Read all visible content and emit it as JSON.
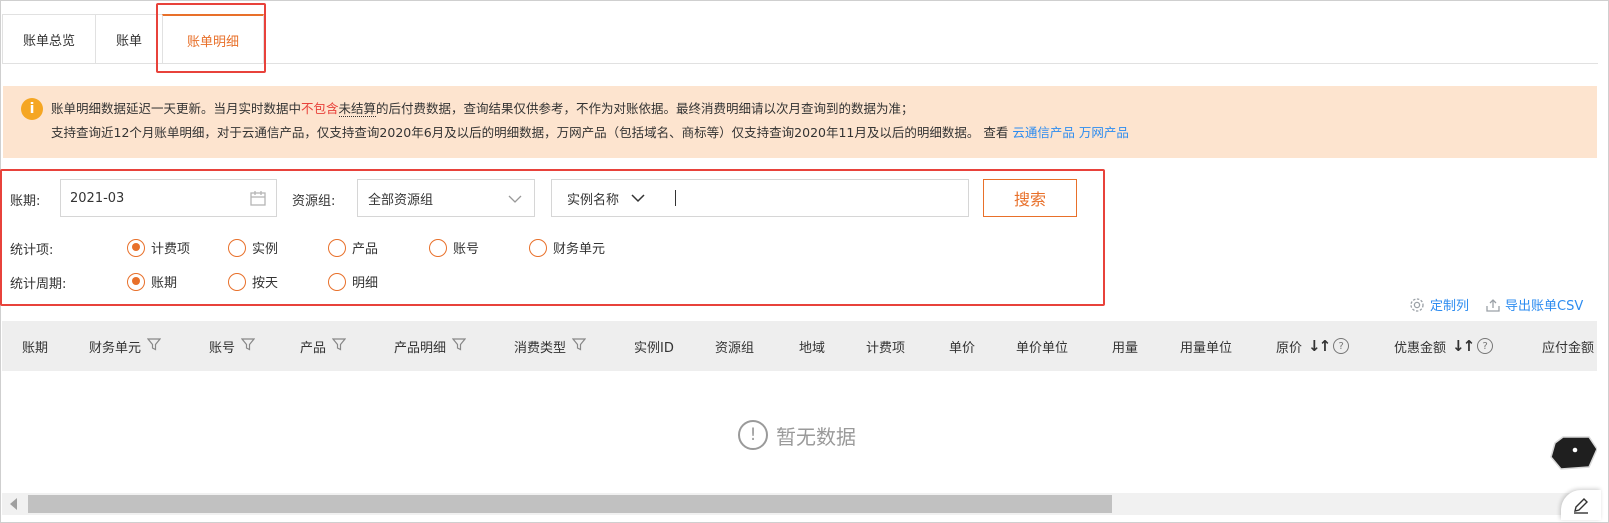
{
  "tabs": [
    {
      "label": "账单总览"
    },
    {
      "label": "账单"
    },
    {
      "label": "账单明细"
    }
  ],
  "notice": {
    "l1_a": "账单明细数据延迟一天更新。当月实时数据中",
    "l1_red": "不包含",
    "l1_dotted": "未结算",
    "l1_b": "的后付费数据，查询结果仅供参考，不作为对账依据。最终消费明细请以次月查询到的数据为准；",
    "l2_a": "支持查询近12个月账单明细，对于云通信产品，仅支持查询2020年6月及以后的明细数据，万网产品（包括域名、商标等）仅支持查询2020年11月及以后的明细数据。 查看 ",
    "link1": "云通信产品",
    "link2": "万网产品"
  },
  "filter": {
    "period_label": "账期:",
    "period_value": "2021-03",
    "group_label": "资源组:",
    "group_value": "全部资源组",
    "search_type": "实例名称",
    "search_value": "",
    "search_button": "搜索",
    "stat_item_label": "统计项:",
    "stat_items": [
      {
        "label": "计费项",
        "checked": true
      },
      {
        "label": "实例",
        "checked": false
      },
      {
        "label": "产品",
        "checked": false
      },
      {
        "label": "账号",
        "checked": false
      },
      {
        "label": "财务单元",
        "checked": false
      }
    ],
    "stat_period_label": "统计周期:",
    "stat_periods": [
      {
        "label": "账期",
        "checked": true
      },
      {
        "label": "按天",
        "checked": false
      },
      {
        "label": "明细",
        "checked": false
      }
    ]
  },
  "tools": {
    "custom_columns": "定制列",
    "export": "导出账单CSV"
  },
  "table": {
    "headers": [
      {
        "label": "账期",
        "filter": false
      },
      {
        "label": "财务单元",
        "filter": true
      },
      {
        "label": "账号",
        "filter": true
      },
      {
        "label": "产品",
        "filter": true
      },
      {
        "label": "产品明细",
        "filter": true
      },
      {
        "label": "消费类型",
        "filter": true
      },
      {
        "label": "实例ID",
        "filter": false
      },
      {
        "label": "资源组",
        "filter": false
      },
      {
        "label": "地域",
        "filter": false
      },
      {
        "label": "计费项",
        "filter": false
      },
      {
        "label": "单价",
        "filter": false
      },
      {
        "label": "单价单位",
        "filter": false
      },
      {
        "label": "用量",
        "filter": false
      },
      {
        "label": "用量单位",
        "filter": false
      },
      {
        "label": "原价",
        "sort": true,
        "help": true
      },
      {
        "label": "优惠金额",
        "sort": true,
        "help": true
      },
      {
        "label": "应付金额",
        "filter": false
      }
    ],
    "empty_text": "暂无数据"
  },
  "colors": {
    "accent": "#e8702a",
    "highlight": "#e8423b",
    "notice_bg": "#fde4cf",
    "link": "#2d8cf0"
  }
}
